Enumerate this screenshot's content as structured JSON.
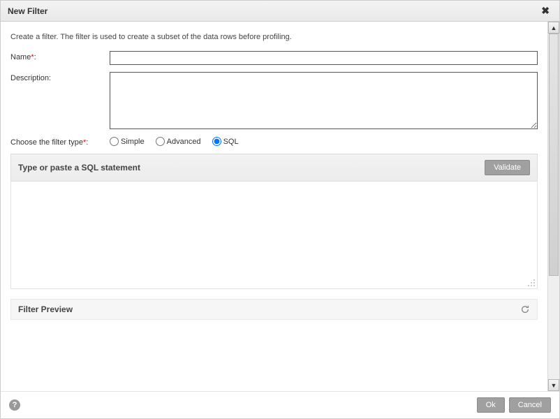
{
  "title": "New Filter",
  "instruction": "Create a filter. The filter is used to create a subset of the data rows before profiling.",
  "form": {
    "name_label": "Name",
    "name_value": "",
    "desc_label": "Description:",
    "desc_value": "",
    "filter_type_label": "Choose the filter type",
    "types": {
      "simple": "Simple",
      "advanced": "Advanced",
      "sql": "SQL"
    },
    "selected_type": "sql"
  },
  "sql_section": {
    "title": "Type or paste a SQL statement",
    "validate_label": "Validate"
  },
  "preview": {
    "title": "Filter Preview"
  },
  "buttons": {
    "ok": "Ok",
    "cancel": "Cancel"
  }
}
